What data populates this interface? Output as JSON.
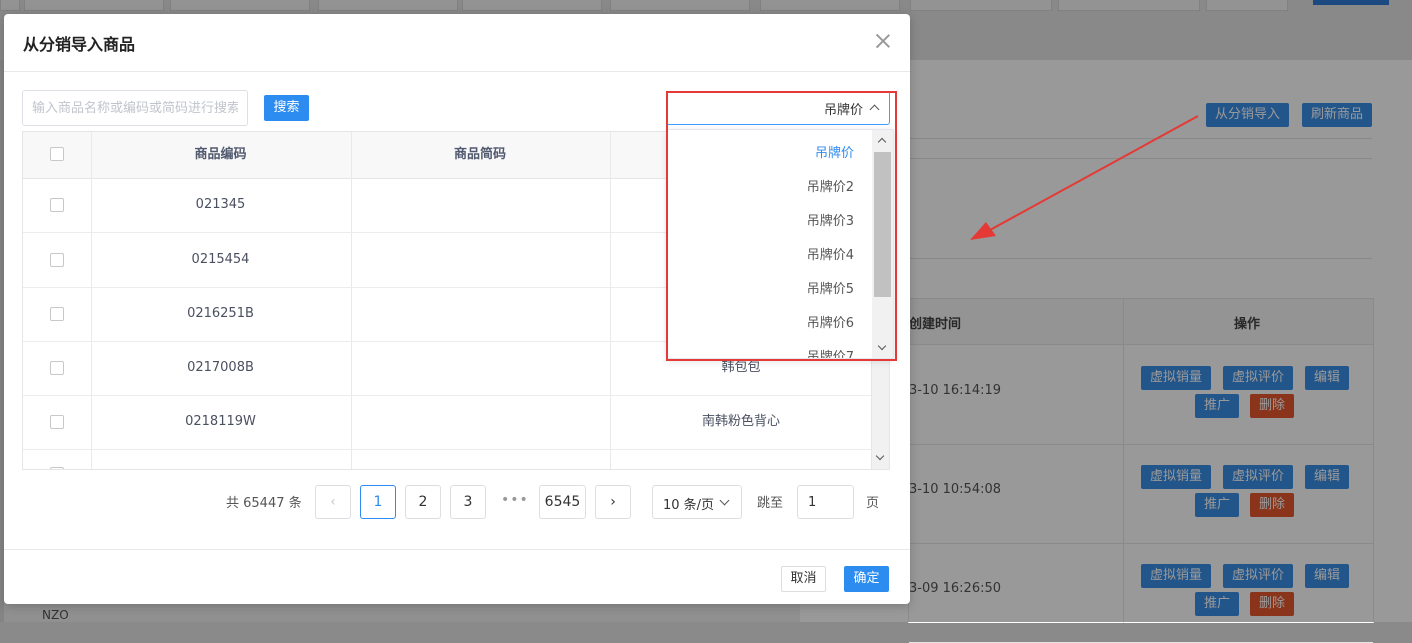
{
  "background": {
    "actions": {
      "import_label": "从分销导入",
      "refresh_label": "刷新商品"
    },
    "table": {
      "headers": {
        "created": "创建时间",
        "ops": "操作"
      },
      "rows": [
        {
          "time": "3-10 16:14:19"
        },
        {
          "time": "3-10 10:54:08"
        },
        {
          "time": "3-09 16:26:50"
        }
      ],
      "row_actions": {
        "virtual_sales": "虚拟销量",
        "virtual_review": "虚拟评价",
        "edit": "编辑",
        "promote": "推广",
        "delete": "删除"
      },
      "partial_left_text": {
        "line1": "NZO"
      }
    }
  },
  "dialog": {
    "title": "从分销导入商品",
    "search": {
      "placeholder": "输入商品名称或编码或简码进行搜索",
      "button": "搜索"
    },
    "price_select": {
      "value": "吊牌价",
      "options": [
        "吊牌价",
        "吊牌价2",
        "吊牌价3",
        "吊牌价4",
        "吊牌价5",
        "吊牌价6",
        "吊牌价7"
      ]
    },
    "table": {
      "headers": {
        "code": "商品编码",
        "short_code": "商品简码"
      },
      "rows": [
        {
          "code": "021345",
          "name": ""
        },
        {
          "code": "0215454",
          "name": ""
        },
        {
          "code": "0216251B",
          "name": ""
        },
        {
          "code": "0217008B",
          "name": "韩包包"
        },
        {
          "code": "0218119W",
          "name": "南韩粉色背心"
        }
      ]
    },
    "pagination": {
      "total": "共 65447 条",
      "pages": [
        "1",
        "2",
        "3",
        "6545"
      ],
      "current": "1",
      "ellipsis": "•••",
      "page_size": "10 条/页",
      "jump_label": "跳至",
      "jump_value": "1",
      "page_label": "页"
    },
    "footer": {
      "cancel": "取消",
      "ok": "确定"
    }
  },
  "colors": {
    "primary": "#2d8cf0",
    "danger": "#e4572e",
    "annotation": "#e53935"
  }
}
